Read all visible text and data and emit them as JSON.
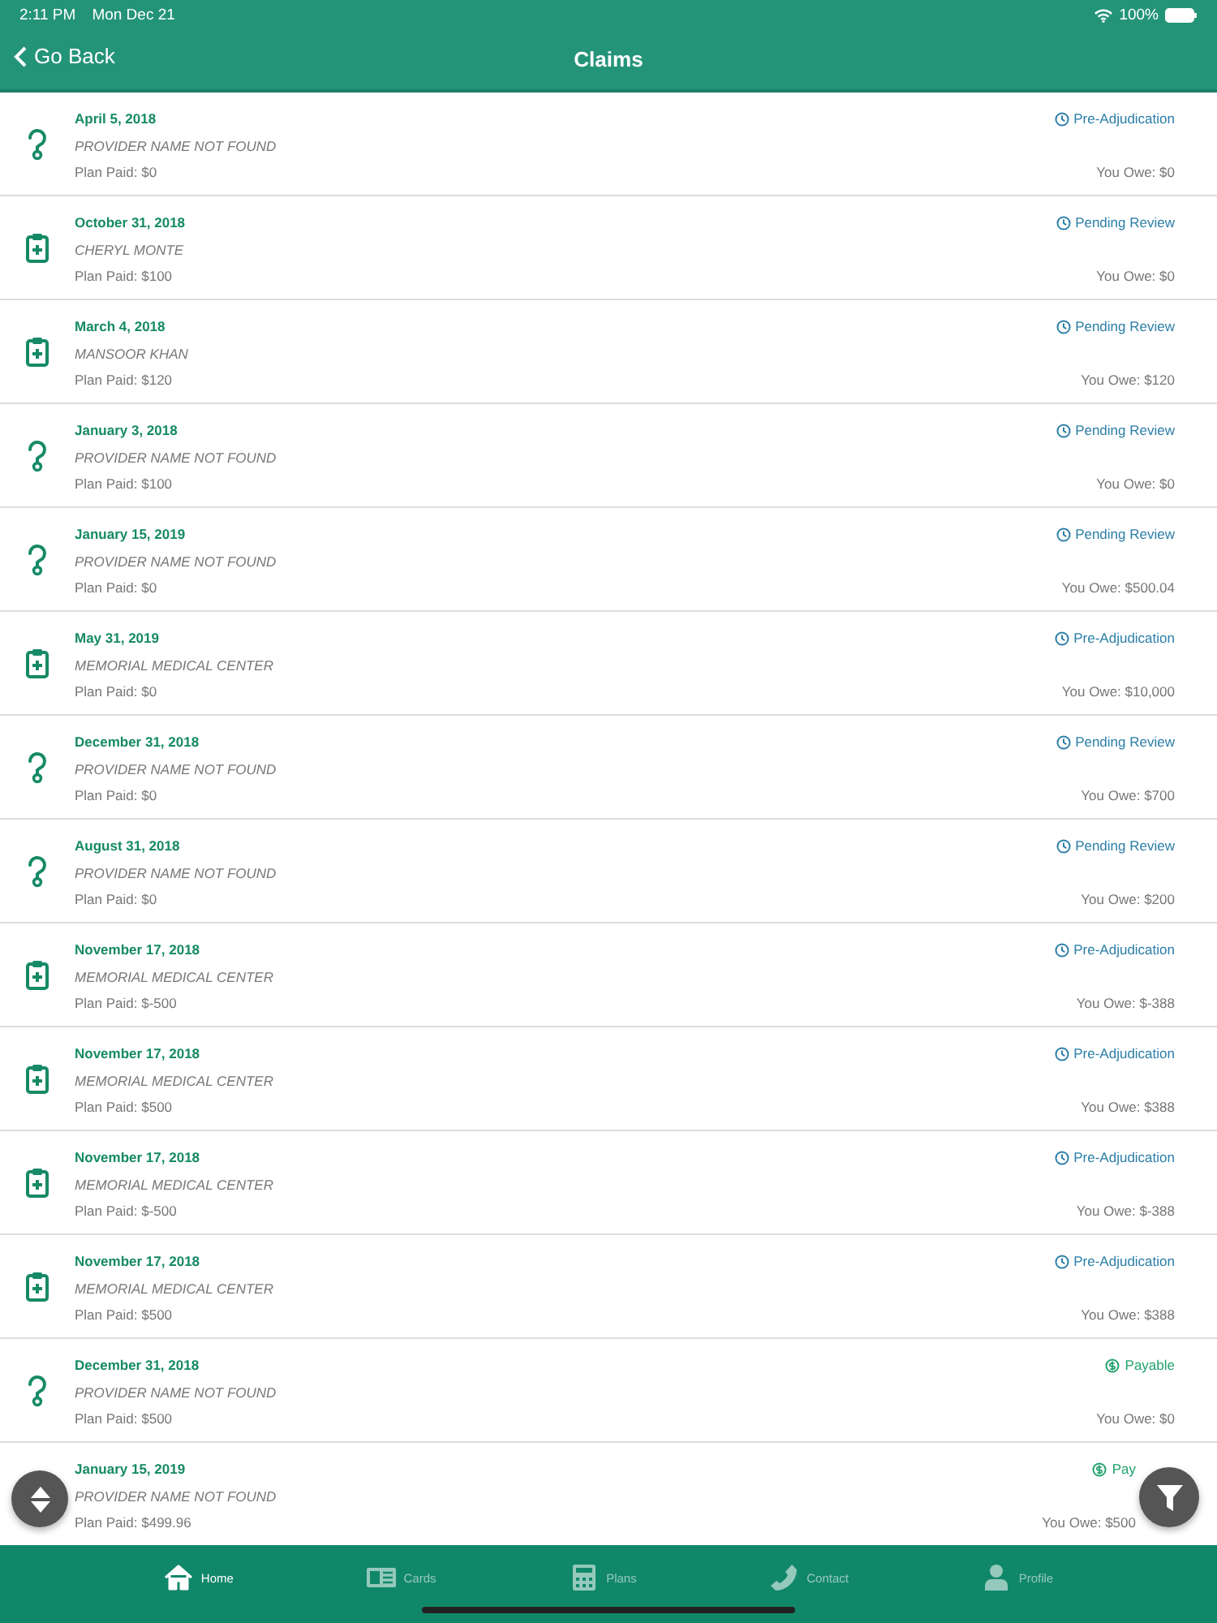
{
  "status_bar": {
    "time": "2:11 PM",
    "date": "Mon Dec 21",
    "battery": "100%"
  },
  "nav": {
    "back": "Go Back",
    "title": "Claims"
  },
  "claims": [
    {
      "kind": "question",
      "date": "April 5, 2018",
      "provider": "PROVIDER NAME NOT FOUND",
      "plan_paid": "Plan Paid: $0",
      "status": {
        "kind": "clock",
        "label": "Pre-Adjudication"
      },
      "you_owe": "You Owe: $0"
    },
    {
      "kind": "clipboard",
      "date": "October 31, 2018",
      "provider": "CHERYL MONTE",
      "plan_paid": "Plan Paid: $100",
      "status": {
        "kind": "clock",
        "label": "Pending Review"
      },
      "you_owe": "You Owe: $0"
    },
    {
      "kind": "clipboard",
      "date": "March 4, 2018",
      "provider": "MANSOOR KHAN",
      "plan_paid": "Plan Paid: $120",
      "status": {
        "kind": "clock",
        "label": "Pending Review"
      },
      "you_owe": "You Owe: $120"
    },
    {
      "kind": "question",
      "date": "January 3, 2018",
      "provider": "PROVIDER NAME NOT FOUND",
      "plan_paid": "Plan Paid: $100",
      "status": {
        "kind": "clock",
        "label": "Pending Review"
      },
      "you_owe": "You Owe: $0"
    },
    {
      "kind": "question",
      "date": "January 15, 2019",
      "provider": "PROVIDER NAME NOT FOUND",
      "plan_paid": "Plan Paid: $0",
      "status": {
        "kind": "clock",
        "label": "Pending Review"
      },
      "you_owe": "You Owe: $500.04"
    },
    {
      "kind": "clipboard",
      "date": "May 31, 2019",
      "provider": "MEMORIAL MEDICAL CENTER",
      "plan_paid": "Plan Paid: $0",
      "status": {
        "kind": "clock",
        "label": "Pre-Adjudication"
      },
      "you_owe": "You Owe: $10,000"
    },
    {
      "kind": "question",
      "date": "December 31, 2018",
      "provider": "PROVIDER NAME NOT FOUND",
      "plan_paid": "Plan Paid: $0",
      "status": {
        "kind": "clock",
        "label": "Pending Review"
      },
      "you_owe": "You Owe: $700"
    },
    {
      "kind": "question",
      "date": "August 31, 2018",
      "provider": "PROVIDER NAME NOT FOUND",
      "plan_paid": "Plan Paid: $0",
      "status": {
        "kind": "clock",
        "label": "Pending Review"
      },
      "you_owe": "You Owe: $200"
    },
    {
      "kind": "clipboard",
      "date": "November 17, 2018",
      "provider": "MEMORIAL MEDICAL CENTER",
      "plan_paid": "Plan Paid: $-500",
      "status": {
        "kind": "clock",
        "label": "Pre-Adjudication"
      },
      "you_owe": "You Owe: $-388"
    },
    {
      "kind": "clipboard",
      "date": "November 17, 2018",
      "provider": "MEMORIAL MEDICAL CENTER",
      "plan_paid": "Plan Paid: $500",
      "status": {
        "kind": "clock",
        "label": "Pre-Adjudication"
      },
      "you_owe": "You Owe: $388"
    },
    {
      "kind": "clipboard",
      "date": "November 17, 2018",
      "provider": "MEMORIAL MEDICAL CENTER",
      "plan_paid": "Plan Paid: $-500",
      "status": {
        "kind": "clock",
        "label": "Pre-Adjudication"
      },
      "you_owe": "You Owe: $-388"
    },
    {
      "kind": "clipboard",
      "date": "November 17, 2018",
      "provider": "MEMORIAL MEDICAL CENTER",
      "plan_paid": "Plan Paid: $500",
      "status": {
        "kind": "clock",
        "label": "Pre-Adjudication"
      },
      "you_owe": "You Owe: $388"
    },
    {
      "kind": "question",
      "date": "December 31, 2018",
      "provider": "PROVIDER NAME NOT FOUND",
      "plan_paid": "Plan Paid: $500",
      "status": {
        "kind": "dollar",
        "label": "Payable"
      },
      "you_owe": "You Owe: $0"
    },
    {
      "date": "January 15, 2019",
      "provider": "PROVIDER NAME NOT FOUND",
      "plan_paid": "Plan Paid: $499.96",
      "status": {
        "kind": "dollar",
        "label": "Pay"
      },
      "you_owe": "You Owe: $500"
    }
  ],
  "tabs": [
    {
      "kind": "home",
      "label": "Home",
      "selected": true
    },
    {
      "kind": "card",
      "label": "Cards",
      "selected": false
    },
    {
      "kind": "calculator",
      "label": "Plans",
      "selected": false
    },
    {
      "kind": "phone",
      "label": "Contact",
      "selected": false
    },
    {
      "kind": "person",
      "label": "Profile",
      "selected": false
    }
  ]
}
